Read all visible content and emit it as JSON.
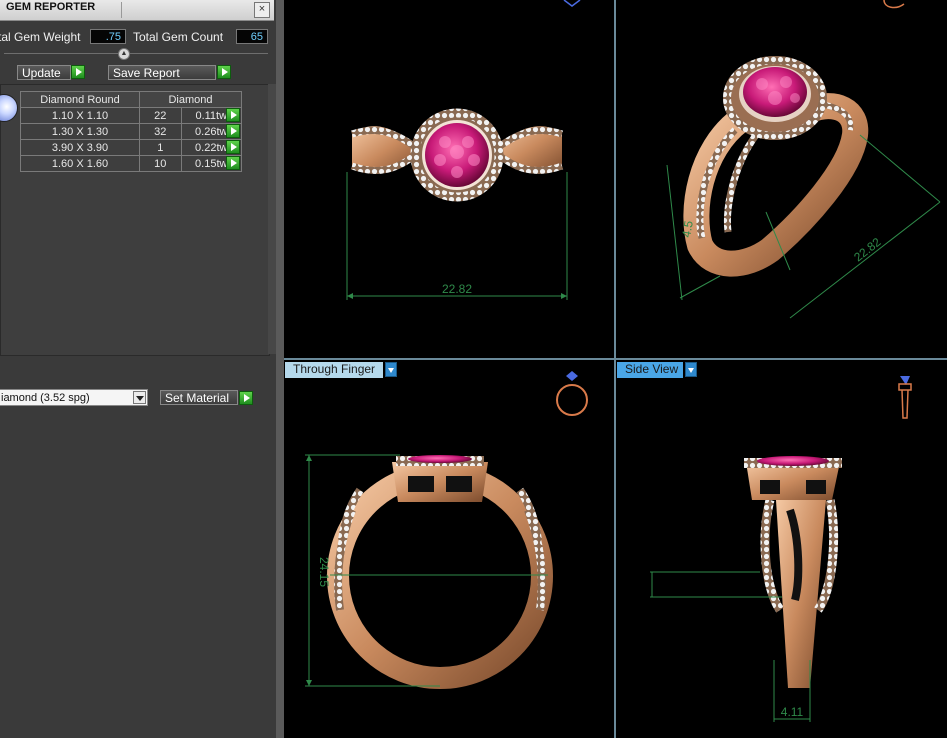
{
  "panel": {
    "title": "GEM REPORTER",
    "close_glyph": "×",
    "total_weight_label": "tal Gem Weight",
    "total_weight_value": ".75",
    "total_count_label": "Total Gem Count",
    "total_count_value": "65",
    "update_label": "Update",
    "save_report_label": "Save Report",
    "gem_icon": "diamond-gem-icon",
    "table": {
      "headers": [
        "Diamond Round",
        "Diamond"
      ],
      "rows": [
        {
          "size": "1.10 X 1.10",
          "count": "22",
          "weight": "0.11tw"
        },
        {
          "size": "1.30 X 1.30",
          "count": "32",
          "weight": "0.26tw"
        },
        {
          "size": "3.90 X 3.90",
          "count": "1",
          "weight": "0.22tw"
        },
        {
          "size": "1.60 X 1.60",
          "count": "10",
          "weight": "0.15tw"
        }
      ]
    },
    "material_select": "iamond     (3.52 spg)",
    "set_material_label": "Set Material"
  },
  "viewports": {
    "top_left": {
      "dimension": "22.82",
      "icon": "camera-top-icon"
    },
    "top_right": {
      "dimension_a": "22.82",
      "dimension_b": "4.5",
      "icon": "camera-perspective-icon"
    },
    "bottom_left": {
      "tab": "Through Finger",
      "dimension": "24.15",
      "icon": "ring-front-icon"
    },
    "bottom_right": {
      "tab": "Side View",
      "dimension": "4.11",
      "icon": "ring-side-icon"
    }
  },
  "colors": {
    "gold": "#d9a27c",
    "ruby": "#c81a78",
    "dim_green": "#2f8a4a",
    "tab_blue": "#4aa6e6"
  }
}
